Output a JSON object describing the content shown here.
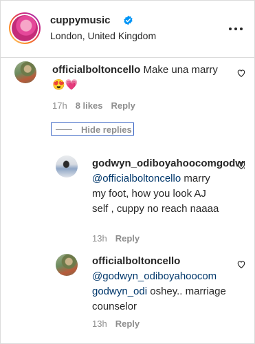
{
  "header": {
    "username": "cuppymusic",
    "location": "London, United Kingdom",
    "verified_icon": "verified-badge-icon",
    "more_icon": "more-options-icon",
    "accent": "#0095f6"
  },
  "comments": [
    {
      "username": "officialboltoncello",
      "text": "Make una marry 😍💗",
      "time": "17h",
      "likes": "8 likes",
      "reply": "Reply"
    }
  ],
  "hide_replies": "Hide replies",
  "replies": [
    {
      "username": "godwyn_odiboyahoocomgodwyn",
      "mention": "@officialboltoncello",
      "text": " marry my foot, how you look AJ self , cuppy no reach naaaa",
      "time": "13h",
      "reply": "Reply"
    },
    {
      "username": "officialboltoncello",
      "mention": "@godwyn_odiboyahoocom godwyn_odi",
      "text": " oshey.. marriage counselor",
      "time": "13h",
      "reply": "Reply"
    }
  ],
  "colors": {
    "text": "#262626",
    "muted": "#8e8e8e",
    "mention": "#00376b",
    "focus_outline": "#3b66c4"
  }
}
